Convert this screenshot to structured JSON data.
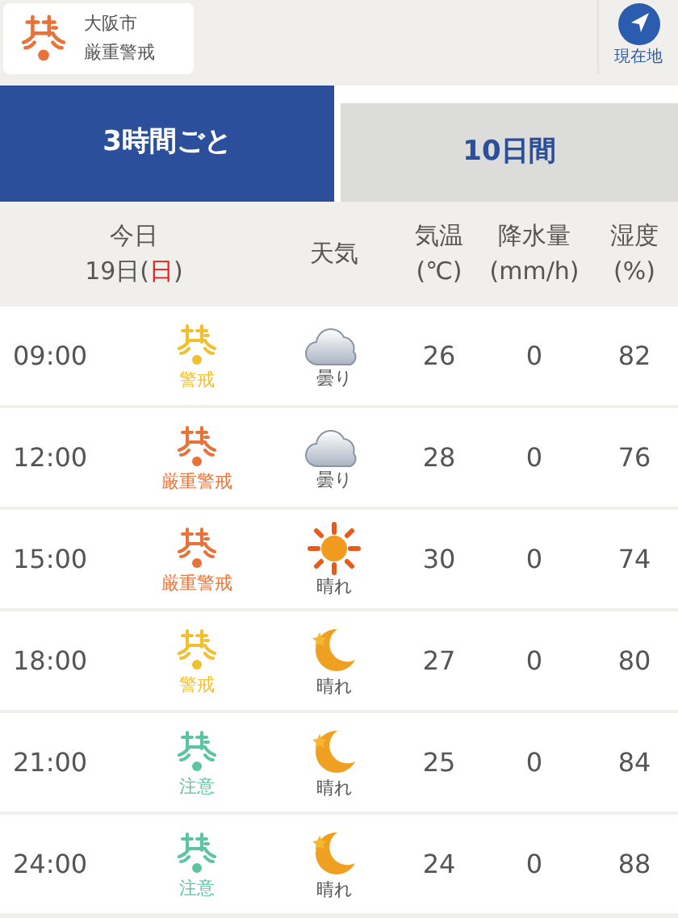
{
  "location": {
    "city": "大阪市",
    "level": "厳重警戒",
    "color": "#e8733a"
  },
  "locate_button": {
    "label": "現在地"
  },
  "tabs": [
    {
      "label": "3時間ごと",
      "selected": true
    },
    {
      "label": "10日間",
      "selected": false
    }
  ],
  "table": {
    "columns": {
      "day": "今日",
      "date_open": "19日(",
      "weekday": "日",
      "date_close": ")",
      "weather": "天気",
      "temp": [
        "気温",
        "(℃)"
      ],
      "precip": [
        "降水量",
        "(mm/h)"
      ],
      "humidity": [
        "湿度",
        "(%)"
      ]
    },
    "rows": [
      {
        "time": "09:00",
        "heat": "警戒",
        "color": "#f0c030",
        "kind": "cloudy",
        "weather": "曇り",
        "temp": "26",
        "precip": "0",
        "humidity": "82"
      },
      {
        "time": "12:00",
        "heat": "厳重警戒",
        "color": "#e8733a",
        "kind": "cloudy",
        "weather": "曇り",
        "temp": "28",
        "precip": "0",
        "humidity": "76"
      },
      {
        "time": "15:00",
        "heat": "厳重警戒",
        "color": "#e8733a",
        "kind": "sunny",
        "weather": "晴れ",
        "temp": "30",
        "precip": "0",
        "humidity": "74"
      },
      {
        "time": "18:00",
        "heat": "警戒",
        "color": "#f0c030",
        "kind": "moon",
        "weather": "晴れ",
        "temp": "27",
        "precip": "0",
        "humidity": "80"
      },
      {
        "time": "21:00",
        "heat": "注意",
        "color": "#5cc4a0",
        "kind": "moon",
        "weather": "晴れ",
        "temp": "25",
        "precip": "0",
        "humidity": "84"
      },
      {
        "time": "24:00",
        "heat": "注意",
        "color": "#5cc4a0",
        "kind": "moon",
        "weather": "晴れ",
        "temp": "24",
        "precip": "0",
        "humidity": "88"
      }
    ]
  }
}
